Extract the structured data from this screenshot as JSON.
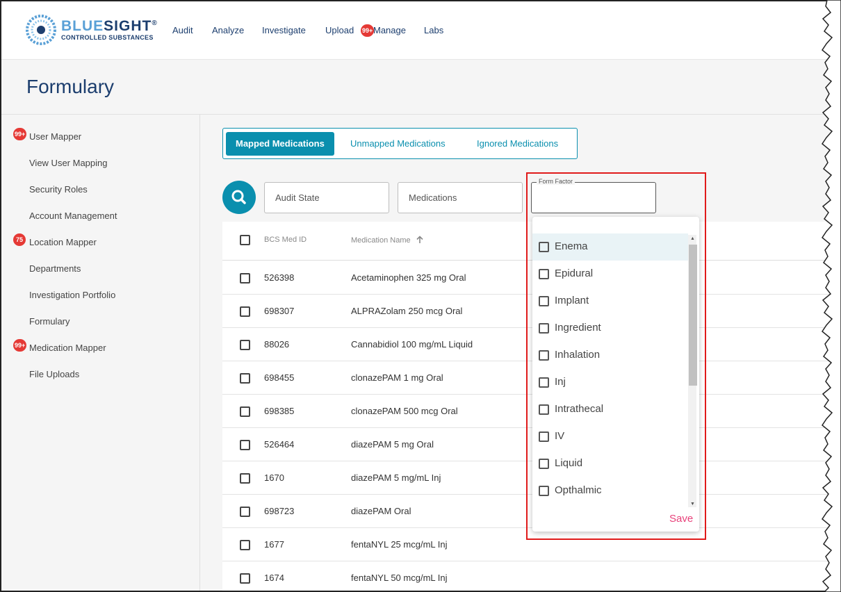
{
  "app": {
    "logo_word_a": "BLUE",
    "logo_word_b": "SIGHT",
    "logo_reg": "®",
    "logo_sub": "CONTROLLED SUBSTANCES"
  },
  "nav": {
    "items": [
      "Audit",
      "Analyze",
      "Investigate",
      "Upload",
      "Manage",
      "Labs"
    ],
    "upload_badge": "99+"
  },
  "page": {
    "title": "Formulary"
  },
  "sidebar": {
    "items": [
      {
        "label": "User Mapper",
        "badge": "99+"
      },
      {
        "label": "View User Mapping",
        "badge": ""
      },
      {
        "label": "Security Roles",
        "badge": ""
      },
      {
        "label": "Account Management",
        "badge": ""
      },
      {
        "label": "Location Mapper",
        "badge": "75"
      },
      {
        "label": "Departments",
        "badge": ""
      },
      {
        "label": "Investigation Portfolio",
        "badge": ""
      },
      {
        "label": "Formulary",
        "badge": ""
      },
      {
        "label": "Medication Mapper",
        "badge": "99+"
      },
      {
        "label": "File Uploads",
        "badge": ""
      }
    ]
  },
  "tabs": [
    "Mapped Medications",
    "Unmapped Medications",
    "Ignored Medications"
  ],
  "filters": {
    "audit_state": "Audit State",
    "medications": "Medications",
    "form_factor_label": "Form Factor"
  },
  "table": {
    "headers": [
      "BCS Med ID",
      "Medication Name"
    ],
    "sort_icon": "arrow-up-icon",
    "rows": [
      {
        "id": "526398",
        "name": "Acetaminophen 325 mg Oral"
      },
      {
        "id": "698307",
        "name": "ALPRAZolam 250 mcg Oral"
      },
      {
        "id": "88026",
        "name": "Cannabidiol 100 mg/mL Liquid"
      },
      {
        "id": "698455",
        "name": "clonazePAM 1 mg Oral"
      },
      {
        "id": "698385",
        "name": "clonazePAM 500 mcg Oral"
      },
      {
        "id": "526464",
        "name": "diazePAM 5 mg Oral"
      },
      {
        "id": "1670",
        "name": "diazePAM 5 mg/mL Inj"
      },
      {
        "id": "698723",
        "name": "diazePAM Oral"
      },
      {
        "id": "1677",
        "name": "fentaNYL 25 mcg/mL Inj"
      },
      {
        "id": "1674",
        "name": "fentaNYL 50 mcg/mL Inj"
      }
    ]
  },
  "dropdown": {
    "options": [
      "Enema",
      "Epidural",
      "Implant",
      "Ingredient",
      "Inhalation",
      "Inj",
      "Intrathecal",
      "IV",
      "Liquid",
      "Opthalmic"
    ],
    "hovered_index": 0,
    "save_label": "Save"
  },
  "colors": {
    "accent": "#0a8fae",
    "brand_navy": "#1c3e6e",
    "badge": "#e53935",
    "save": "#e8417a",
    "highlight": "#e01a1a"
  }
}
